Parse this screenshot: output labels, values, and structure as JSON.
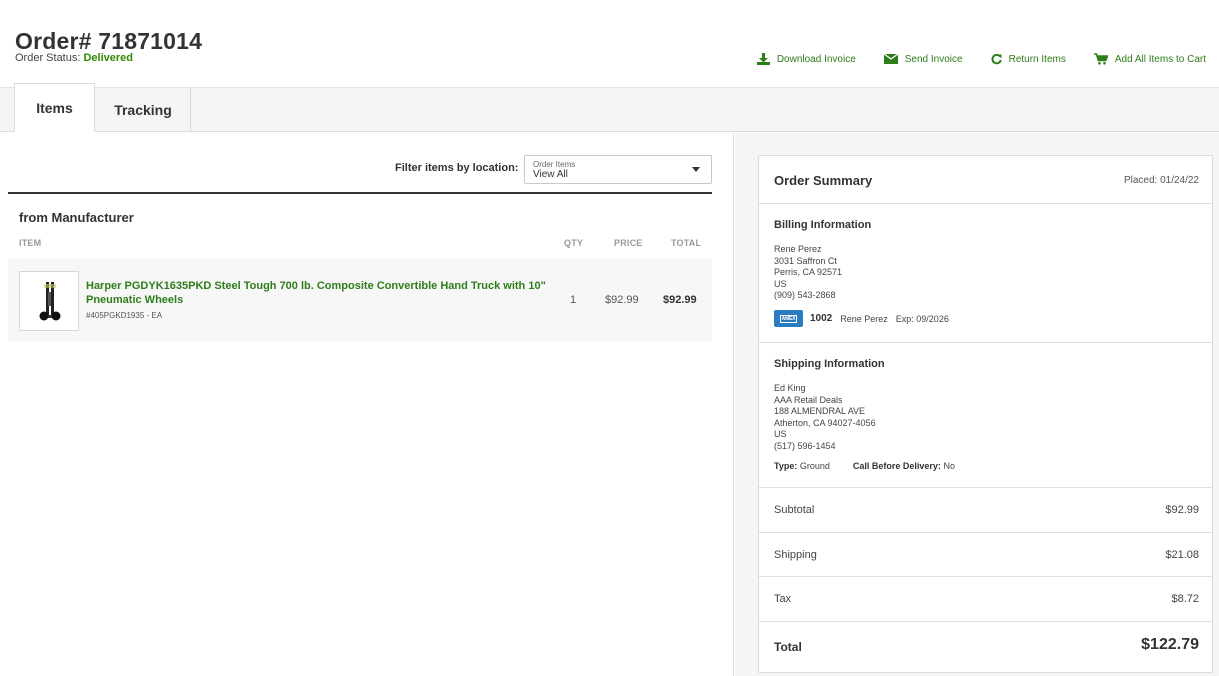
{
  "header": {
    "order_title": "Order# 71871014",
    "status_label": "Order Status:",
    "status_value": "Delivered",
    "actions": {
      "download_invoice": "Download Invoice",
      "send_invoice": "Send Invoice",
      "return_items": "Return Items",
      "add_all_to_cart": "Add All Items to Cart"
    }
  },
  "tabs": {
    "items": "Items",
    "tracking": "Tracking"
  },
  "items_panel": {
    "filter_label": "Filter items by location:",
    "filter_caption": "Order Items",
    "filter_value": "View All",
    "group_title": "from Manufacturer",
    "columns": {
      "item": "ITEM",
      "qty": "QTY",
      "price": "PRICE",
      "total": "TOTAL"
    },
    "rows": [
      {
        "name": "Harper PGDYK1635PKD Steel Tough 700 lb. Composite Convertible Hand Truck with 10\" Pneumatic Wheels",
        "sku": "#405PGKD1935 - EA",
        "qty": "1",
        "price": "$92.99",
        "total": "$92.99"
      }
    ]
  },
  "summary": {
    "title": "Order Summary",
    "placed": "Placed: 01/24/22",
    "billing": {
      "title": "Billing Information",
      "lines": [
        "Rene Perez",
        "3031 Saffron Ct",
        "Perris, CA 92571",
        "US",
        "(909) 543-2868"
      ],
      "card_brand": "AMEX",
      "card_last4": "1002",
      "card_holder": "Rene Perez",
      "card_exp": "Exp: 09/2026"
    },
    "shipping": {
      "title": "Shipping Information",
      "lines": [
        "Ed King",
        "AAA Retail Deals",
        "188 ALMENDRAL AVE",
        "Atherton, CA 94027-4056",
        "US",
        "(517) 596-1454"
      ],
      "type_label": "Type:",
      "type_value": "Ground",
      "call_label": "Call Before Delivery:",
      "call_value": "No"
    },
    "subtotal_label": "Subtotal",
    "subtotal_value": "$92.99",
    "shipping_label": "Shipping",
    "shipping_value": "$21.08",
    "tax_label": "Tax",
    "tax_value": "$8.72",
    "total_label": "Total",
    "total_value": "$122.79"
  }
}
